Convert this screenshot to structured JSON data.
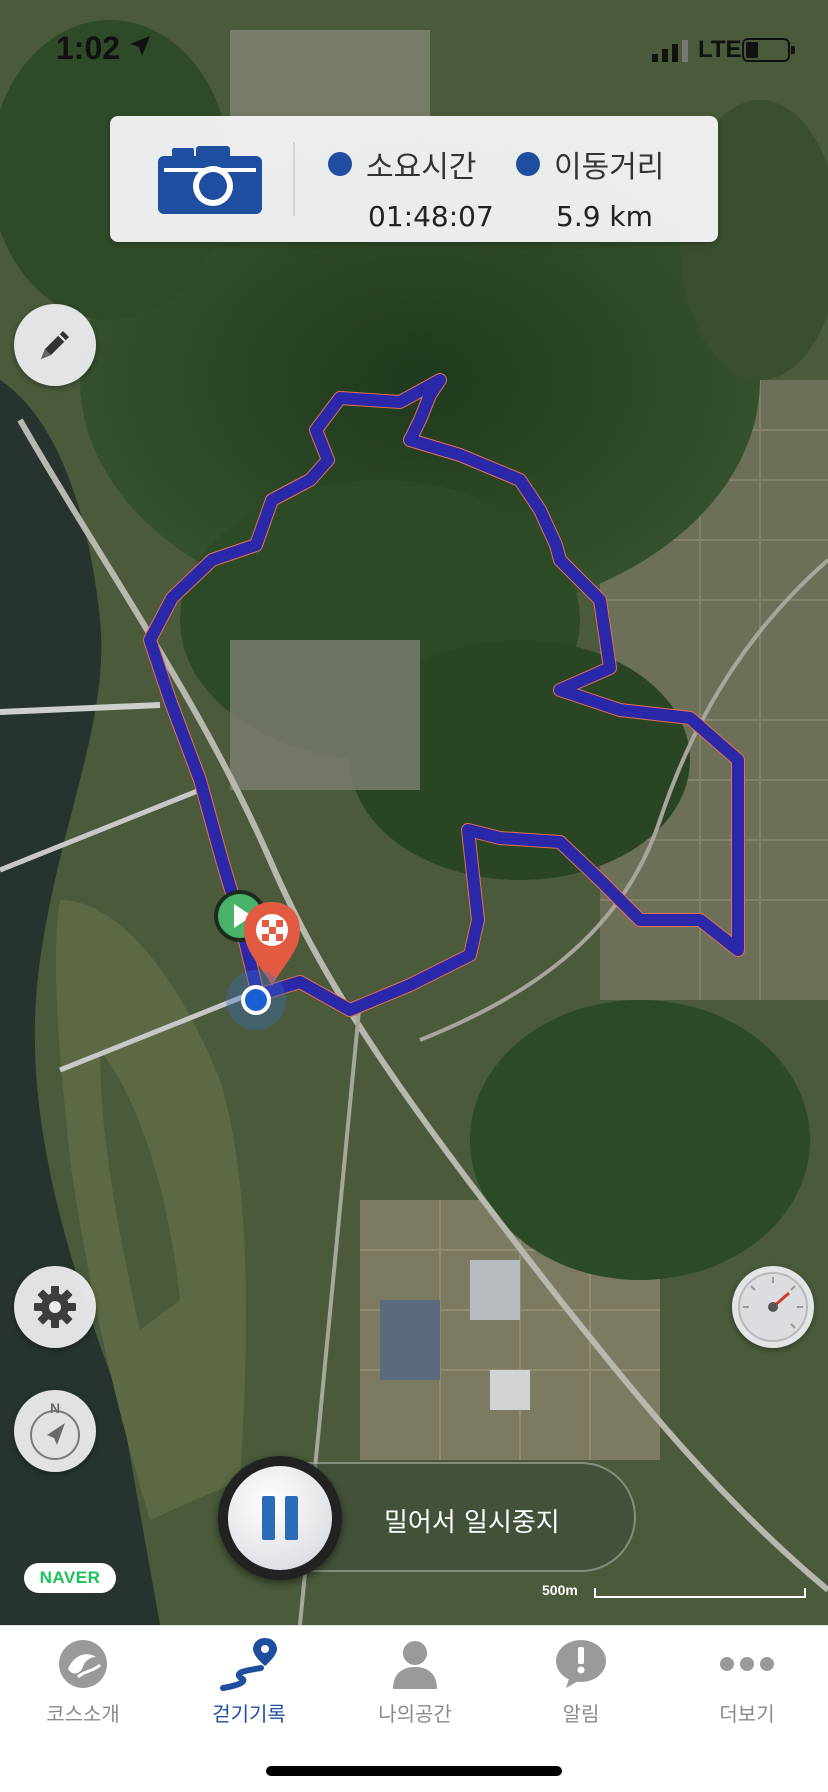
{
  "status_bar": {
    "time": "1:02",
    "carrier": "LTE"
  },
  "stats": {
    "camera_icon": "camera-icon",
    "elapsed_label": "소요시간",
    "elapsed_value": "01:48:07",
    "distance_label": "이동거리",
    "distance_value": "5.9 km"
  },
  "map": {
    "scale_label": "500m",
    "provider_logo": "NAVER",
    "route_color": "#2a27a8",
    "accent_route_color": "#e4704f"
  },
  "controls": {
    "edit_icon": "pencil-icon",
    "settings_icon": "gear-icon",
    "compass_label": "N",
    "speedometer_icon": "speedometer-icon"
  },
  "slider": {
    "label": "밀어서 일시중지"
  },
  "tabs": [
    {
      "label": "코스소개",
      "icon": "course-intro-icon"
    },
    {
      "label": "걷기기록",
      "icon": "walk-record-icon",
      "active": true
    },
    {
      "label": "나의공간",
      "icon": "person-icon"
    },
    {
      "label": "알림",
      "icon": "notice-icon"
    },
    {
      "label": "더보기",
      "icon": "more-icon"
    }
  ],
  "colors": {
    "brand_blue": "#1f4ea0",
    "tab_inactive": "#8a8a8a"
  }
}
